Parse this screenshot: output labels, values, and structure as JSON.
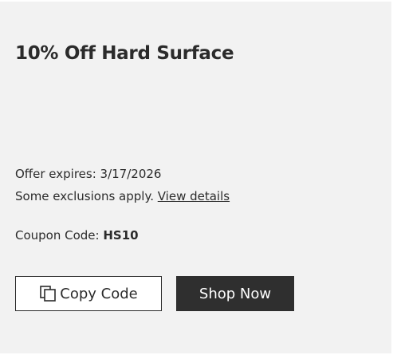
{
  "offer": {
    "title": "10% Off Hard Surface",
    "expires": "Offer expires: 3/17/2026",
    "exclusions_text": "Some exclusions apply.",
    "details_link": "View details",
    "coupon_label": "Coupon Code:",
    "coupon_code": "HS10"
  },
  "actions": {
    "copy_label": "Copy Code",
    "copy_icon": "copy-icon",
    "shop_label": "Shop Now"
  },
  "colors": {
    "card_background": "#f2f2f2",
    "primary_button": "#2f2f2f",
    "text": "#2b2b2b"
  }
}
